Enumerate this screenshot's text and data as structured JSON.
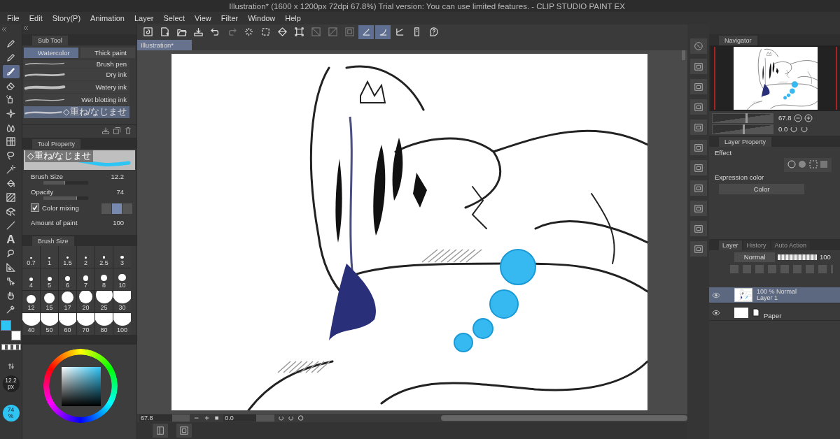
{
  "window": {
    "title": "Illustration* (1600 x 1200px 72dpi 67.8%)  Trial version: You can use limited features. - CLIP STUDIO PAINT EX"
  },
  "menu": [
    "File",
    "Edit",
    "Story(P)",
    "Animation",
    "Layer",
    "Select",
    "View",
    "Filter",
    "Window",
    "Help"
  ],
  "tools": [
    {
      "kind": "pen",
      "selected": false
    },
    {
      "kind": "pencil",
      "selected": false
    },
    {
      "kind": "brush",
      "selected": true
    },
    {
      "kind": "eraser",
      "selected": false
    },
    {
      "kind": "airbrush",
      "selected": false
    },
    {
      "kind": "decoration",
      "selected": false
    },
    {
      "kind": "blend",
      "selected": false
    },
    {
      "kind": "figure",
      "selected": false
    },
    {
      "kind": "lasso",
      "selected": false
    },
    {
      "kind": "wand",
      "selected": false
    },
    {
      "kind": "fill",
      "selected": false
    },
    {
      "kind": "gradient",
      "selected": false
    },
    {
      "kind": "operation",
      "selected": false
    },
    {
      "kind": "line",
      "selected": false
    },
    {
      "kind": "text",
      "glyph": "A",
      "selected": false
    },
    {
      "kind": "balloon",
      "selected": false
    },
    {
      "kind": "ruler",
      "selected": false
    },
    {
      "kind": "move",
      "selected": false
    },
    {
      "kind": "hand",
      "selected": false
    },
    {
      "kind": "eyedropper",
      "selected": false
    }
  ],
  "command_bar": [
    {
      "kind": "logo",
      "on": false,
      "disabled": false
    },
    {
      "kind": "new",
      "on": false,
      "disabled": false
    },
    {
      "kind": "open",
      "on": false,
      "disabled": false
    },
    {
      "kind": "export",
      "on": false,
      "disabled": false
    },
    {
      "kind": "undo",
      "on": false,
      "disabled": false
    },
    {
      "kind": "redo",
      "on": false,
      "disabled": true
    },
    {
      "kind": "loading",
      "on": false,
      "disabled": false
    },
    {
      "kind": "clear",
      "on": false,
      "disabled": false
    },
    {
      "kind": "fill-area",
      "on": false,
      "disabled": false
    },
    {
      "kind": "transform",
      "on": false,
      "disabled": false
    },
    {
      "kind": "deselect",
      "on": false,
      "disabled": true
    },
    {
      "kind": "invert",
      "on": false,
      "disabled": true
    },
    {
      "kind": "crop",
      "on": false,
      "disabled": true
    },
    {
      "kind": "snap-ruler",
      "on": true,
      "disabled": false
    },
    {
      "kind": "snap-special",
      "on": true,
      "disabled": false
    },
    {
      "kind": "snap-grid",
      "on": false,
      "disabled": false
    },
    {
      "kind": "phone",
      "on": false,
      "disabled": false
    },
    {
      "kind": "help",
      "on": false,
      "disabled": false
    }
  ],
  "document_tab": {
    "label": "Illustration*"
  },
  "sub_tool": {
    "title": "Sub Tool",
    "groups": [
      {
        "label": "Watercolor",
        "selected": true
      },
      {
        "label": "Thick paint",
        "selected": false
      }
    ],
    "brushes": [
      {
        "name": "Brush pen",
        "selected": false
      },
      {
        "name": "Dry ink",
        "selected": false
      },
      {
        "name": "Watery ink",
        "selected": false
      },
      {
        "name": "Wet blotting ink",
        "selected": false
      },
      {
        "name": "◇重ね/なじませ",
        "selected": true
      }
    ]
  },
  "tool_property": {
    "title": "Tool Property",
    "preview_label": "◇重ね/なじませ",
    "properties": [
      {
        "kind": "slider",
        "label": "Brush Size",
        "value": "12.2",
        "level": 0.47
      },
      {
        "kind": "slider",
        "label": "Opacity",
        "value": "74",
        "level": 0.74
      },
      {
        "kind": "checkbox",
        "label": "Color mixing",
        "checked": true
      },
      {
        "kind": "number",
        "label": "Amount of paint",
        "value": "100"
      }
    ]
  },
  "brush_size_palette": {
    "title": "Brush Size",
    "sizes": [
      "0.7",
      "1",
      "1.5",
      "2",
      "2.5",
      "3",
      "4",
      "5",
      "6",
      "7",
      "8",
      "10",
      "12",
      "15",
      "17",
      "20",
      "25",
      "30",
      "40",
      "50",
      "60",
      "70",
      "80",
      "100"
    ]
  },
  "swatches": [
    {
      "kind": "main",
      "color": "#2ec4f4"
    },
    {
      "kind": "sub",
      "color": "#ffffff"
    }
  ],
  "indicators": {
    "size": "12.2",
    "size_unit": "px",
    "opacity": "74",
    "opacity_unit": "%"
  },
  "navigator": {
    "title": "Navigator",
    "zoom": "67.8",
    "zoom_slider": {
      "level": 0.55
    },
    "rotation": "0.0",
    "rotation_slider": {
      "level": 0.5
    }
  },
  "layer_property": {
    "title": "Layer Property",
    "effect_label": "Effect",
    "expression_color_label": "Expression color",
    "expression_color": "Color"
  },
  "layer_panel": {
    "tabs": [
      {
        "label": "Layer",
        "selected": true
      },
      {
        "label": "History",
        "selected": false
      },
      {
        "label": "Auto Action",
        "selected": false
      }
    ],
    "blend_mode": "Normal",
    "opacity_slider": {
      "level": 1
    },
    "opacity": "100",
    "layers": [
      {
        "kind": "raster",
        "mode": "100 % Normal",
        "name": "Layer 1",
        "selected": true,
        "visible": true
      },
      {
        "kind": "paper",
        "name": "Paper",
        "selected": false,
        "visible": true
      }
    ]
  },
  "status": {
    "zoom": "67.8",
    "rotation": "0.0"
  }
}
